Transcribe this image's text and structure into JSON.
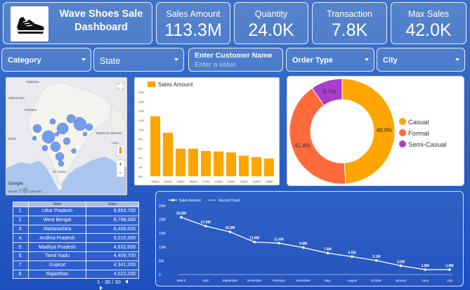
{
  "header": {
    "title_line1": "Wave Shoes Sale",
    "title_line2": "Dashboard",
    "logo_icon": "sneaker-icon"
  },
  "kpis": [
    {
      "label": "Sales Amount",
      "value": "113.3M"
    },
    {
      "label": "Quantity",
      "value": "24.0K"
    },
    {
      "label": "Transaction",
      "value": "7.8K"
    },
    {
      "label": "Max Sales",
      "value": "42.0K"
    }
  ],
  "filters": {
    "category": "Category",
    "state": "State",
    "customer_label": "Enter Customer Name",
    "customer_placeholder": "Enter a value",
    "order_type": "Order Type",
    "city": "City"
  },
  "map": {
    "labels": [
      "Tajikistan",
      "Afghanistan",
      "Pakistan",
      "Oman",
      "Myanmar (Burma)",
      "Sri Lanka",
      "Nepal",
      "Laos"
    ],
    "google_label": "Google",
    "legend_min": "100,000",
    "legend_max": "8,900,000"
  },
  "bar_chart": {
    "legend": "Sales Amount",
    "legend_color": "#ffa500",
    "ylabels": [
      "18M",
      "16M",
      "14M",
      "12M",
      "10M",
      "8M",
      "6M",
      "4M",
      "2M",
      "0M"
    ]
  },
  "donut_legend": {
    "items": [
      {
        "label": "Casual",
        "color": "#ffa500"
      },
      {
        "label": "Formal",
        "color": "#ff6a3d"
      },
      {
        "label": "Semi-Casual",
        "color": "#a83ec9"
      }
    ]
  },
  "line_legend": {
    "sales": "Sales Amount",
    "record": "Record Count"
  },
  "table": {
    "headers": [
      "",
      "State",
      "Sales"
    ],
    "rows": [
      {
        "n": "1.",
        "state": "Uttar Pradesh",
        "sales": "8,953,700"
      },
      {
        "n": "2.",
        "state": "West Bengal",
        "sales": "8,798,300"
      },
      {
        "n": "3.",
        "state": "Maharashtra",
        "sales": "6,406,500"
      },
      {
        "n": "4.",
        "state": "Andhra Pradesh",
        "sales": "6,010,300"
      },
      {
        "n": "5.",
        "state": "Madhya Pradesh",
        "sales": "4,632,600"
      },
      {
        "n": "6.",
        "state": "Tamil Nadu",
        "sales": "4,409,700"
      },
      {
        "n": "7.",
        "state": "Gujarat",
        "sales": "4,341,200"
      },
      {
        "n": "8.",
        "state": "Rajasthan",
        "sales": "4,023,200"
      }
    ],
    "pager": "1 - 30 / 30"
  },
  "chart_data": [
    {
      "type": "bar",
      "title": "",
      "series": [
        {
          "name": "Sales Amount",
          "values": [
            12.8,
            9.3,
            5.9,
            5.9,
            5.4,
            5.3,
            5.1,
            4.4,
            4.1,
            3.8
          ]
        }
      ],
      "categories": [
        "34000",
        "16000",
        "19000",
        "26000",
        "17900",
        "14300",
        "10300",
        "13400",
        "19200",
        "10950"
      ],
      "ylim": [
        0,
        18
      ],
      "xlabel": "",
      "ylabel": "",
      "legend": "top-left"
    },
    {
      "type": "pie",
      "title": "",
      "labels": [
        "Casual",
        "Formal",
        "Semi-Casual"
      ],
      "values": [
        48.9,
        41.4,
        9.7
      ],
      "colors": [
        "#ffa500",
        "#ff6a3d",
        "#a83ec9"
      ],
      "data_labels": [
        "48.9%",
        "41.4%",
        "9.7%"
      ],
      "legend": "right"
    },
    {
      "type": "line",
      "title": "",
      "categories": [
        "March",
        "April",
        "September",
        "November",
        "February",
        "December",
        "May",
        "August",
        "October",
        "January",
        "June",
        "July"
      ],
      "series": [
        {
          "name": "Sales Amount",
          "values": [
            20.8,
            17.6,
            15.5,
            11.8,
            11.4,
            9.8,
            7.8,
            6.5,
            5.1,
            3.2,
            1.8,
            1.8
          ]
        }
      ],
      "data_labels": [
        "20.8M",
        "17.6M",
        "15.5M",
        "11.8M",
        "11.4M",
        "9.8M",
        "7.8M",
        "6.5M",
        "5.1M",
        "3.2M",
        "1.8M",
        "1.8M"
      ],
      "ylabels": [
        "25M",
        "20M",
        "15M",
        "10M",
        "5M",
        "0"
      ],
      "ylim": [
        0,
        25
      ],
      "legend": "top-left"
    }
  ]
}
